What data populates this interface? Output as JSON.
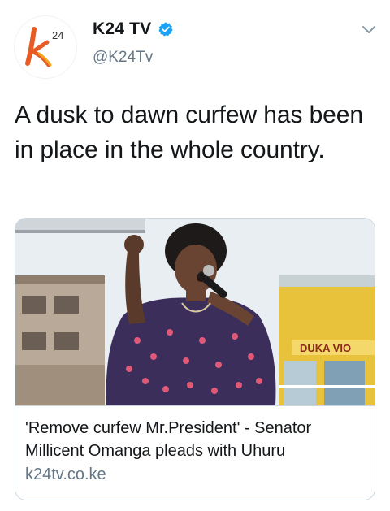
{
  "account": {
    "display_name": "K24 TV",
    "handle": "@K24Tv",
    "verified_icon": "verified-badge-icon",
    "avatar_icon": "k24-logo-icon",
    "avatar_text": "24"
  },
  "menu": {
    "icon": "chevron-down-icon"
  },
  "tweet": {
    "text": "A dusk to dawn curfew has been in place in the whole country."
  },
  "card": {
    "image_icon": "woman-speaking-photo",
    "title": "'Remove curfew Mr.President' - Senator Millicent Omanga pleads with Uhuru",
    "domain": "k24tv.co.ke",
    "sign_text": "DUKA VIO"
  },
  "colors": {
    "brand_accent": "#e85b24",
    "verified_blue": "#1da1f2",
    "text_primary": "#14171a",
    "text_secondary": "#657786",
    "border": "#ccd6dd"
  }
}
